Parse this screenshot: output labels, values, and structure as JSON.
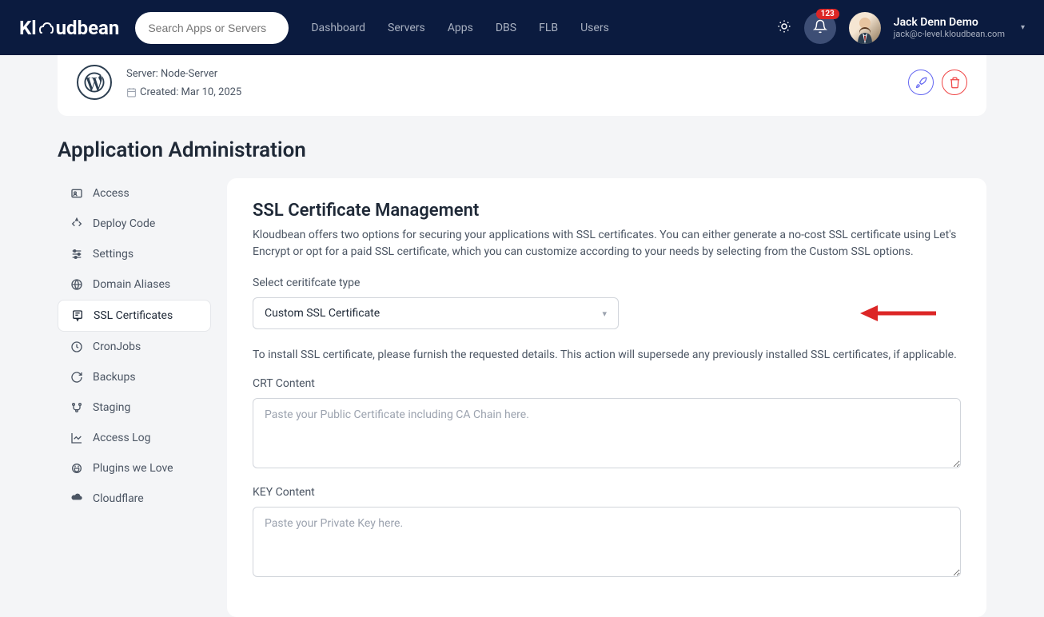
{
  "header": {
    "logo_text": "Kloudbean",
    "search_placeholder": "Search Apps or Servers",
    "nav": [
      {
        "label": "Dashboard"
      },
      {
        "label": "Servers"
      },
      {
        "label": "Apps"
      },
      {
        "label": "DBS"
      },
      {
        "label": "FLB"
      },
      {
        "label": "Users"
      }
    ],
    "badge_count": "123",
    "user_name": "Jack Denn Demo",
    "user_email": "jack@c-level.kloudbean.com"
  },
  "app_header": {
    "server_label": "Server: Node-Server",
    "created_label": "Created: Mar 10, 2025"
  },
  "page_title": "Application Administration",
  "sidebar": {
    "items": [
      {
        "label": "Access",
        "icon": "id-card"
      },
      {
        "label": "Deploy Code",
        "icon": "code"
      },
      {
        "label": "Settings",
        "icon": "sliders"
      },
      {
        "label": "Domain Aliases",
        "icon": "globe"
      },
      {
        "label": "SSL Certificates",
        "icon": "certificate",
        "active": true
      },
      {
        "label": "CronJobs",
        "icon": "clock"
      },
      {
        "label": "Backups",
        "icon": "refresh"
      },
      {
        "label": "Staging",
        "icon": "branch"
      },
      {
        "label": "Access Log",
        "icon": "chart"
      },
      {
        "label": "Plugins we Love",
        "icon": "plug"
      },
      {
        "label": "Cloudflare",
        "icon": "cloud"
      }
    ]
  },
  "panel": {
    "title": "SSL Certificate Management",
    "desc": "Kloudbean offers two options for securing your applications with SSL certificates. You can either generate a no-cost SSL certificate using Let's Encrypt or opt for a paid SSL certificate, which you can customize according to your needs by selecting from the Custom SSL options.",
    "select_label": "Select ceritifcate type",
    "select_value": "Custom SSL Certificate",
    "install_note": "To install SSL certificate, please furnish the requested details. This action will supersede any previously installed SSL certificates, if applicable.",
    "crt_label": "CRT Content",
    "crt_placeholder": "Paste your Public Certificate including CA Chain here.",
    "key_label": "KEY Content",
    "key_placeholder": "Paste your Private Key here."
  }
}
